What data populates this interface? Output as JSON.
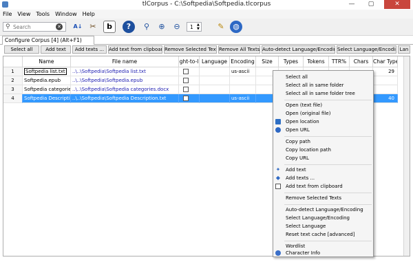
{
  "window": {
    "title": "tlCorpus - C:\\Softpedia\\Softpedia.tlcorpus",
    "controls": [
      "—",
      "▢",
      "✕"
    ]
  },
  "menu": [
    "File",
    "View",
    "Tools",
    "Window",
    "Help"
  ],
  "toolbar": {
    "search_placeholder": "Search",
    "stepper_value": "1",
    "icons": [
      "sort-az-icon",
      "tools-icon",
      "format-b-icon",
      "help-icon",
      "zoom-icon",
      "zoom-in-icon",
      "zoom-out-icon",
      "notepad-icon",
      "globe-icon"
    ]
  },
  "tab": {
    "label": "Configure Corpus [4] (Alt+F1)"
  },
  "actions": [
    "Select all",
    "Add text",
    "Add texts ...",
    "Add text from clipboard",
    "Remove Selected Texts",
    "Remove All Texts",
    "Auto-detect Language/Encoding",
    "Select Language/Encoding",
    "Lan"
  ],
  "grid": {
    "columns": [
      "",
      "Name",
      "File name",
      "ght-to-l",
      "Language",
      "Encoding",
      "Size",
      "Types",
      "Tokens",
      "TTR%",
      "Chars",
      "Char Type"
    ],
    "rows": [
      {
        "num": "1",
        "name": "Softpedia list.txt",
        "file": "..\\..\\Softpedia\\Softpedia list.txt",
        "encoding": "us-ascii",
        "size": "",
        "types": "",
        "tokens": "",
        "ttr": "",
        "chars": "",
        "chartypes": "29"
      },
      {
        "num": "2",
        "name": "Softpedia.epub",
        "file": "..\\..\\Softpedia\\Softpedia.epub",
        "encoding": "",
        "size": "",
        "types": "",
        "tokens": "",
        "ttr": "",
        "chars": "",
        "chartypes": ""
      },
      {
        "num": "3",
        "name": "Softpedia categories d...",
        "file": "..\\..\\Softpedia\\Softpedia categories.docx",
        "encoding": "",
        "size": "",
        "types": "",
        "tokens": "",
        "ttr": "",
        "chars": "",
        "chartypes": ""
      },
      {
        "num": "4",
        "name": "Softpedia Description...",
        "file": "..\\..\\Softpedia\\Softpedia Description.txt",
        "encoding": "us-ascii",
        "size": "",
        "types": "",
        "tokens": "",
        "ttr": "",
        "chars": "",
        "chartypes": "40"
      }
    ]
  },
  "context_menu": [
    {
      "label": "Select all"
    },
    {
      "label": "Select all in same folder"
    },
    {
      "label": "Select all in same folder tree"
    },
    {
      "sep": true
    },
    {
      "label": "Open (text file)"
    },
    {
      "label": "Open (original file)"
    },
    {
      "label": "Open location",
      "icon": "folder-icon"
    },
    {
      "label": "Open URL",
      "icon": "globe-icon"
    },
    {
      "sep": true
    },
    {
      "label": "Copy path"
    },
    {
      "label": "Copy location path"
    },
    {
      "label": "Copy URL"
    },
    {
      "sep": true
    },
    {
      "label": "Add text",
      "icon": "add-icon"
    },
    {
      "label": "Add texts ...",
      "icon": "tag-icon"
    },
    {
      "label": "Add text from clipboard",
      "icon": "clipboard-icon"
    },
    {
      "sep": true
    },
    {
      "label": "Remove Selected Texts"
    },
    {
      "sep": true
    },
    {
      "label": "Auto-detect Language/Encoding"
    },
    {
      "label": "Select Language/Encoding"
    },
    {
      "label": "Select Language"
    },
    {
      "label": "Reset text cache [advanced]"
    },
    {
      "sep": true
    },
    {
      "label": "Wordlist"
    },
    {
      "label": "Character Info",
      "icon": "charinfo-icon"
    }
  ],
  "colors": {
    "selection": "#3399ff",
    "close": "#c9463d",
    "link": "#1a1ab0"
  }
}
